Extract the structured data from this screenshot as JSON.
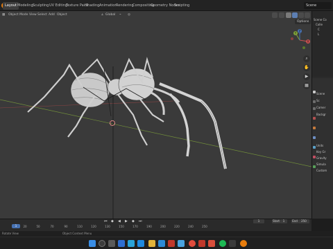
{
  "topbar": {
    "tabs": [
      "Layout",
      "Modeling",
      "Sculpting",
      "UV Editing",
      "Texture Paint",
      "Shading",
      "Animation",
      "Rendering",
      "Compositing",
      "Geometry Nodes",
      "Scripting"
    ],
    "scene_label": "Scene"
  },
  "viewport": {
    "mode": "Object Mode",
    "menus": [
      "View",
      "Select",
      "Add",
      "Object"
    ],
    "transform_orientation": "Global",
    "options_label": "Options",
    "gizmo": {
      "x": "X",
      "y": "Y",
      "z": "Z"
    }
  },
  "timeline": {
    "current_frame": "1",
    "ticks": [
      "1",
      "20",
      "50",
      "70",
      "90",
      "110",
      "120",
      "130",
      "150",
      "170",
      "190",
      "200",
      "220",
      "240",
      "250"
    ],
    "start_label": "Start",
    "start_value": "1",
    "end_label": "End",
    "end_value": "250"
  },
  "outliner": {
    "rows": [
      "Scene Co",
      "Colle",
      "C",
      "L"
    ]
  },
  "properties": {
    "rows": [
      "Scene",
      "Sc",
      "Camer",
      "Backgr",
      "Units",
      "Key Gr",
      "Gravity",
      "Simula",
      "Custom"
    ]
  },
  "statusbar": {
    "left": "Rotate View",
    "middle": "Object Context Menu"
  },
  "taskbar": {
    "icons": [
      "windows-start",
      "search",
      "task-view",
      "widgets",
      "file-explorer",
      "edge-browser",
      "store",
      "chrome",
      "mail",
      "spotify",
      "blender"
    ]
  },
  "colors": {
    "accent": "#4772b3",
    "viewport_bg": "#3a3a3a",
    "axis_x": "#b44a4a",
    "axis_y": "#7fa33a"
  }
}
